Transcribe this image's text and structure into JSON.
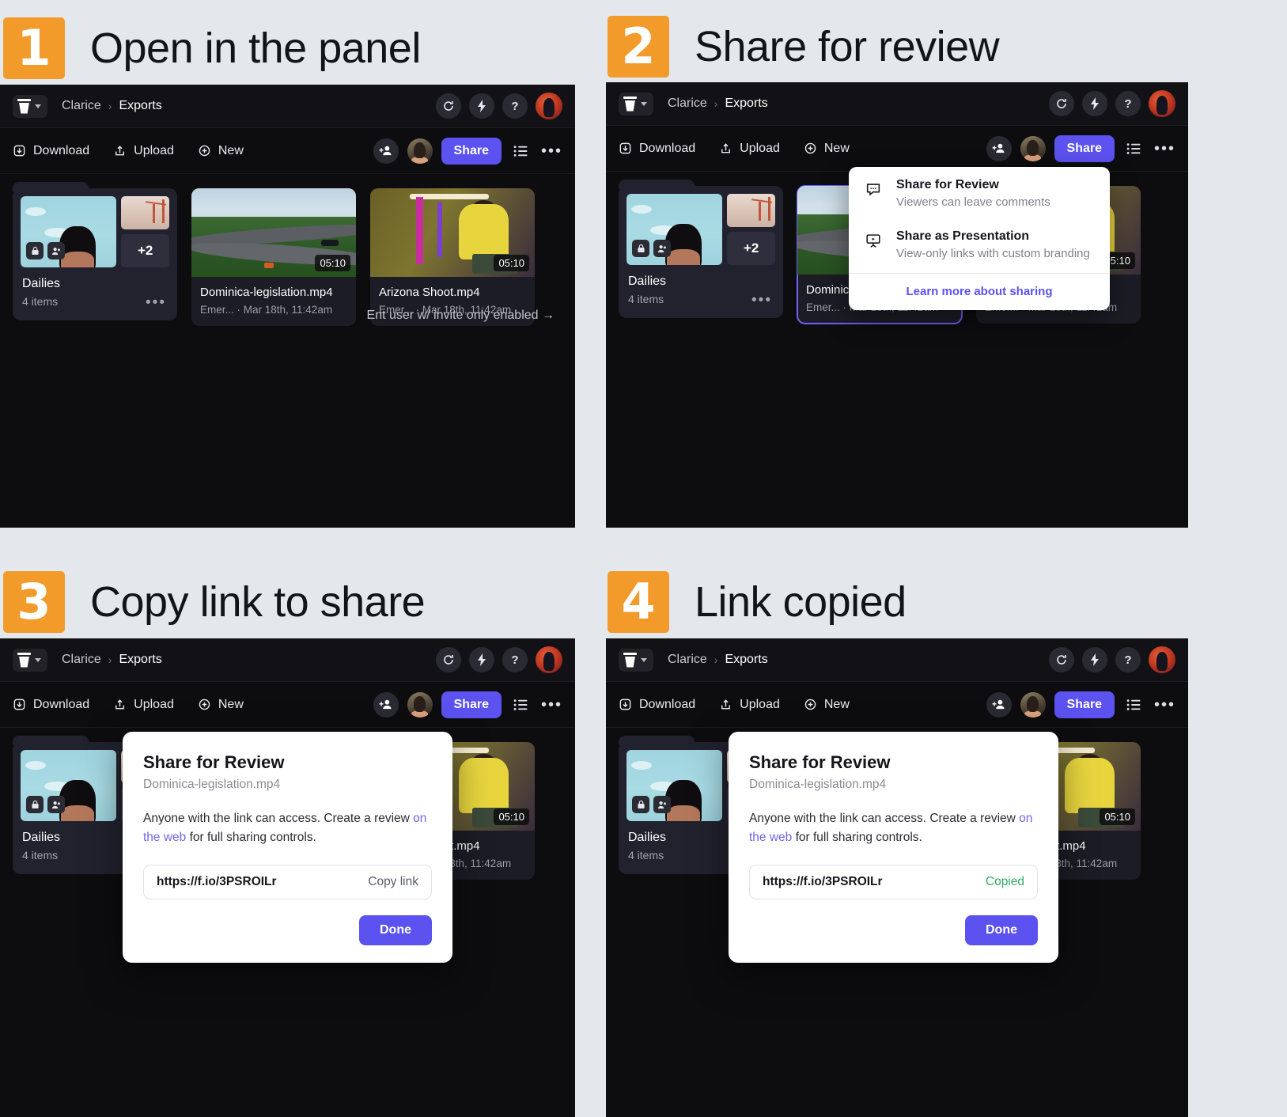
{
  "steps": [
    {
      "number": "1",
      "title": "Open in the panel"
    },
    {
      "number": "2",
      "title": "Share for review"
    },
    {
      "number": "3",
      "title": "Copy link to share"
    },
    {
      "number": "4",
      "title": "Link copied"
    }
  ],
  "app": {
    "breadcrumb": {
      "root": "Clarice",
      "separator": "›",
      "current": "Exports"
    },
    "topbar_icons": [
      "refresh-icon",
      "lightning-icon",
      "help-icon",
      "user-avatar"
    ],
    "help_glyph": "?",
    "toolbar": {
      "download": "Download",
      "upload": "Upload",
      "new": "New",
      "share": "Share",
      "add_user_icon": "add-user-icon",
      "list_view_icon": "list-view-icon",
      "more_icon": "more-options-icon",
      "more_glyph": "•••"
    },
    "cards": [
      {
        "type": "folder",
        "name": "Dailies",
        "sub": "4 items",
        "extra_count": "+2",
        "more_glyph": "•••"
      },
      {
        "type": "video",
        "name": "Dominica-legislation.mp4",
        "sub": "Emer... · Mar 18th, 11:42am",
        "duration": "05:10"
      },
      {
        "type": "video",
        "name": "Arizona Shoot.mp4",
        "sub": "Emer... · Mar 18th, 11:42am",
        "duration": "05:10"
      }
    ],
    "hint": "Ent user w/ invite only enabled →"
  },
  "share_menu": {
    "items": [
      {
        "title": "Share for Review",
        "subtitle": "Viewers can leave comments",
        "icon": "comment-bubble-icon"
      },
      {
        "title": "Share as Presentation",
        "subtitle": "View-only links with custom branding",
        "icon": "presentation-icon"
      }
    ],
    "link": "Learn more about sharing"
  },
  "share_dialog": {
    "title": "Share for Review",
    "filename": "Dominica-legislation.mp4",
    "body_part1": "Anyone with the link can access. Create a review ",
    "body_link": "on the web",
    "body_part2": " for full sharing controls.",
    "url": "https://f.io/3PSROILr",
    "copy_label": "Copy link",
    "copied_label": "Copied",
    "done_label": "Done"
  },
  "colors": {
    "badge_orange": "#f29b2b",
    "accent_purple": "#5b52ef",
    "copied_green": "#2fae62",
    "canvas": "#e4e7eb",
    "app_bg": "#0d0d10"
  }
}
